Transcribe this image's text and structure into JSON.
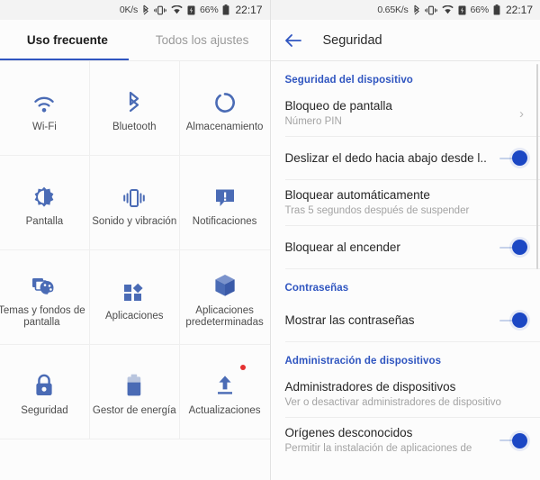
{
  "left": {
    "status_bar": {
      "network_speed": "0K/s",
      "icons": [
        "bluetooth-icon",
        "vibrate-icon",
        "wifi-icon",
        "sim-icon"
      ],
      "battery_percent": "66%",
      "clock": "22:17"
    },
    "tabs": [
      {
        "label": "Uso frecuente",
        "active": true
      },
      {
        "label": "Todos los ajustes",
        "active": false
      }
    ],
    "grid": [
      {
        "icon": "wifi-icon",
        "label": "Wi-Fi",
        "badge": false
      },
      {
        "icon": "bluetooth-icon",
        "label": "Bluetooth",
        "badge": false
      },
      {
        "icon": "storage-icon",
        "label": "Almacenamiento",
        "badge": false
      },
      {
        "icon": "brightness-icon",
        "label": "Pantalla",
        "badge": false
      },
      {
        "icon": "vibrate-icon",
        "label": "Sonido y vibración",
        "badge": false
      },
      {
        "icon": "notification-icon",
        "label": "Notificaciones",
        "badge": false
      },
      {
        "icon": "theme-icon",
        "label": "Temas y fondos de\npantalla",
        "badge": false
      },
      {
        "icon": "apps-icon",
        "label": "Aplicaciones",
        "badge": false
      },
      {
        "icon": "box-icon",
        "label": "Aplicaciones\npredeterminadas",
        "badge": false
      },
      {
        "icon": "lock-icon",
        "label": "Seguridad",
        "badge": false
      },
      {
        "icon": "battery-icon",
        "label": "Gestor de energía",
        "badge": false
      },
      {
        "icon": "update-icon",
        "label": "Actualizaciones",
        "badge": true
      }
    ]
  },
  "right": {
    "status_bar": {
      "network_speed": "0.65K/s",
      "icons": [
        "bluetooth-icon",
        "vibrate-icon",
        "wifi-icon",
        "sim-icon"
      ],
      "battery_percent": "66%",
      "clock": "22:17"
    },
    "appbar": {
      "back": "back-arrow-icon",
      "title": "Seguridad"
    },
    "sections": [
      {
        "header": "Seguridad del dispositivo",
        "rows": [
          {
            "title": "Bloqueo de pantalla",
            "sub": "Número PIN",
            "control": "chevron",
            "chevron": "›"
          },
          {
            "title": "Deslizar el dedo hacia abajo desde l..",
            "sub": "",
            "control": "switch",
            "on": true
          },
          {
            "title": "Bloquear automáticamente",
            "sub": "Tras 5 segundos después de suspender",
            "control": "none"
          },
          {
            "title": "Bloquear al encender",
            "sub": "",
            "control": "switch",
            "on": true
          }
        ]
      },
      {
        "header": "Contraseñas",
        "rows": [
          {
            "title": "Mostrar las contraseñas",
            "sub": "",
            "control": "switch",
            "on": true
          }
        ]
      },
      {
        "header": "Administración de dispositivos",
        "rows": [
          {
            "title": "Administradores de dispositivos",
            "sub": "Ver o desactivar administradores de dispositivo",
            "control": "none"
          },
          {
            "title": "Orígenes desconocidos",
            "sub": "Permitir la instalación de aplicaciones de",
            "control": "switch",
            "on": true
          }
        ]
      }
    ]
  },
  "colors": {
    "accent": "#2f55c0",
    "icon_blue": "#4a6bb5",
    "switch_on": "#1b47c4",
    "badge_red": "#e53030",
    "background": "#fcfcfc"
  }
}
